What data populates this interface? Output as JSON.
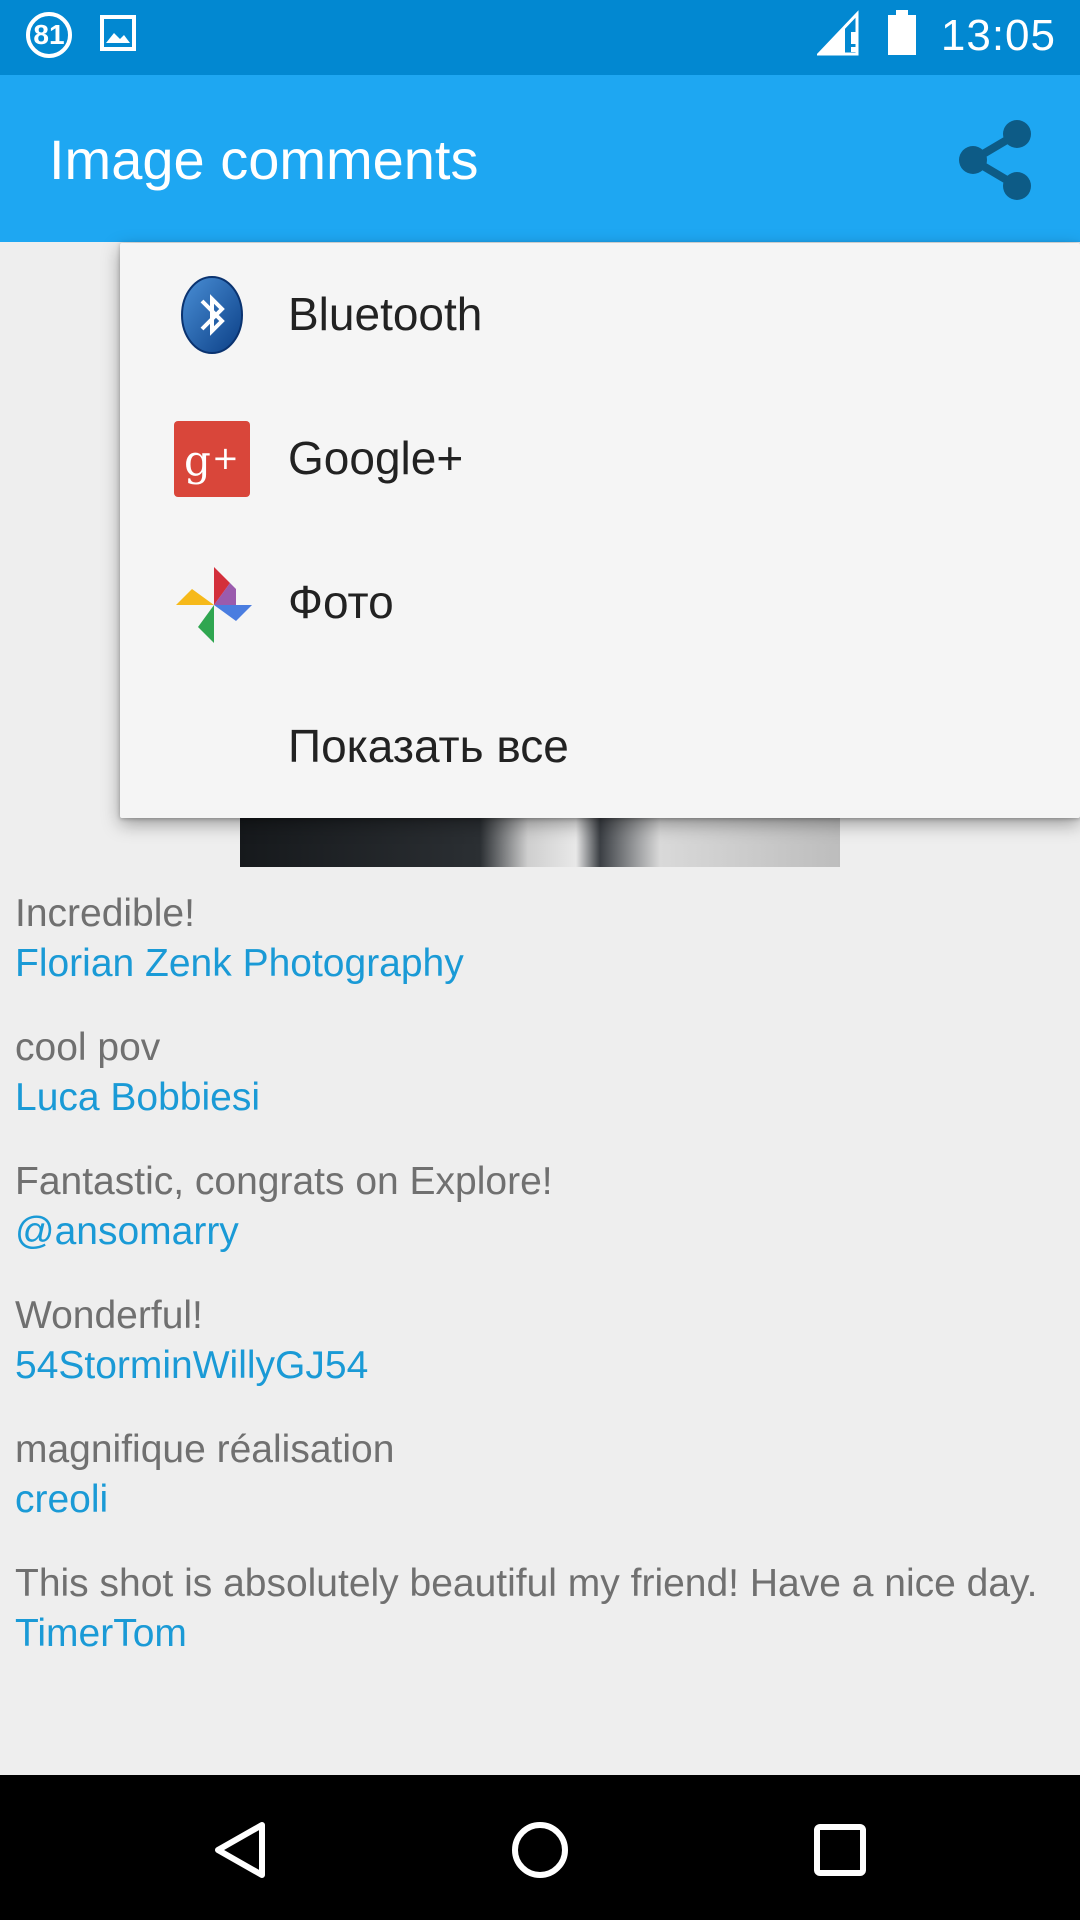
{
  "status_bar": {
    "notification_count": "81",
    "time": "13:05",
    "icons": [
      "notification-count-icon",
      "image-icon",
      "signal-icon",
      "battery-icon"
    ]
  },
  "app_bar": {
    "title": "Image comments",
    "share_icon": "share-icon"
  },
  "share_menu": {
    "items": [
      {
        "label": "Bluetooth",
        "icon": "bluetooth-icon"
      },
      {
        "label": "Google+",
        "icon": "google-plus-icon"
      },
      {
        "label": "Фото",
        "icon": "photos-icon"
      },
      {
        "label": "Показать все",
        "icon": ""
      }
    ]
  },
  "comments": [
    {
      "text": "Incredible!",
      "author": "Florian Zenk Photography"
    },
    {
      "text": "cool pov",
      "author": "Luca Bobbiesi"
    },
    {
      "text": "Fantastic, congrats on Explore!",
      "author": "@ansomarry"
    },
    {
      "text": "Wonderful!",
      "author": "54StorminWillyGJ54"
    },
    {
      "text": "magnifique réalisation",
      "author": "creoli"
    },
    {
      "text": "This shot is absolutely beautiful my friend! Have a nice day.",
      "author": "TimerTom"
    }
  ],
  "nav_bar": {
    "icons": [
      "back-icon",
      "home-icon",
      "recents-icon"
    ]
  },
  "colors": {
    "status_bar": "#0288d1",
    "app_bar": "#1ea7f2",
    "author_link": "#1a9ad6",
    "comment_text": "#707070",
    "background": "#eeeeee"
  }
}
